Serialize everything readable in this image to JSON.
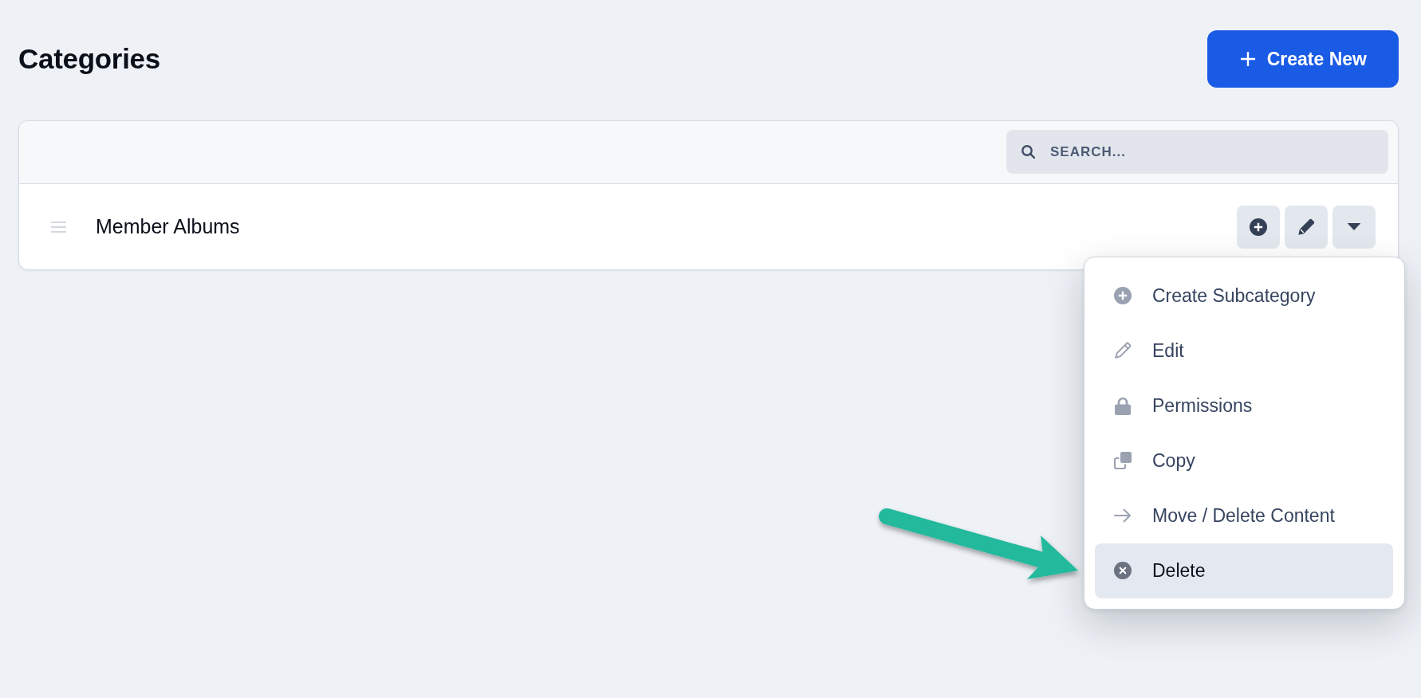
{
  "header": {
    "title": "Categories",
    "create_button": {
      "label": "Create New"
    }
  },
  "search": {
    "placeholder": "SEARCH..."
  },
  "categories": [
    {
      "name": "Member Albums",
      "menu_open": true,
      "menu": [
        {
          "label": "Create Subcategory",
          "highlighted": false
        },
        {
          "label": "Edit",
          "highlighted": false
        },
        {
          "label": "Permissions",
          "highlighted": false
        },
        {
          "label": "Copy",
          "highlighted": false
        },
        {
          "label": "Move / Delete Content",
          "highlighted": false
        },
        {
          "label": "Delete",
          "highlighted": true
        }
      ]
    }
  ]
}
